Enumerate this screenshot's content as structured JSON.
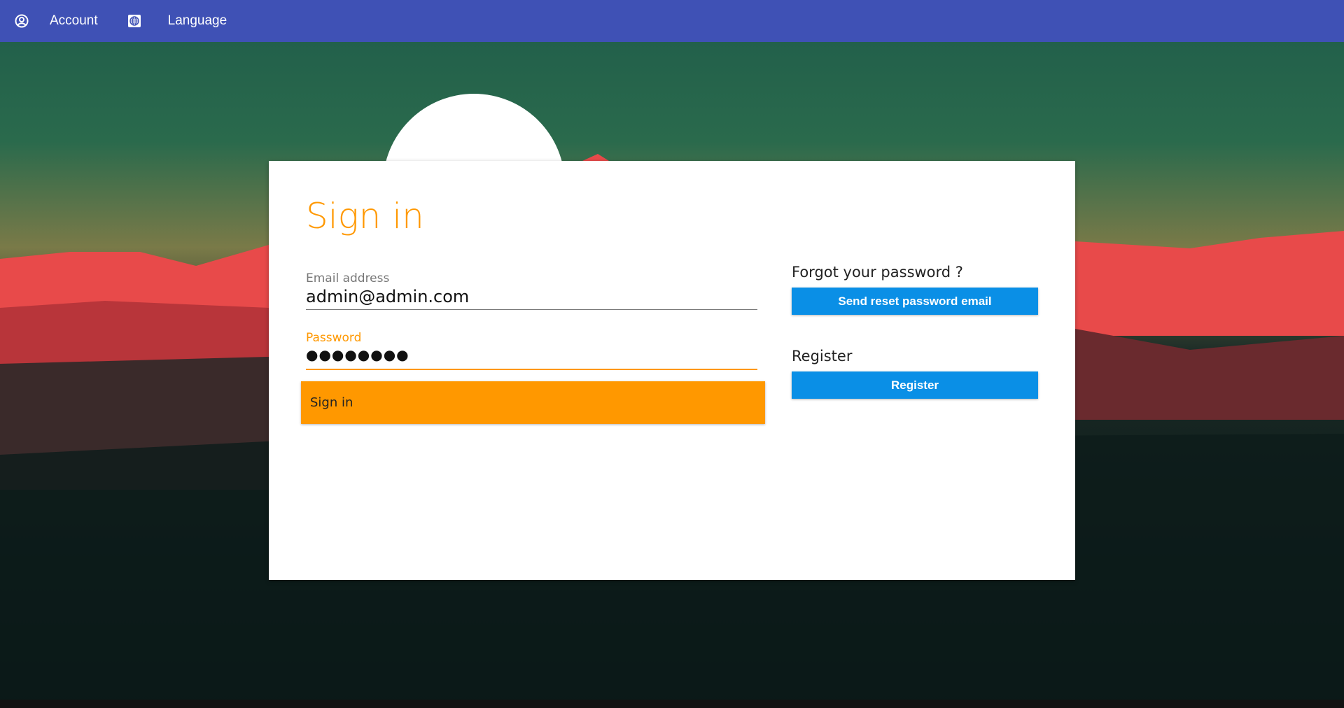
{
  "nav": {
    "account_label": "Account",
    "language_label": "Language",
    "color": "#3f51b5"
  },
  "signin": {
    "title": "Sign in",
    "email_label": "Email address",
    "email_value": "admin@admin.com",
    "password_label": "Password",
    "password_value": "●●●●●●●●",
    "submit_label": "Sign in",
    "accent": "#ff9800"
  },
  "side": {
    "forgot_heading": "Forgot your password ?",
    "reset_button": "Send reset password email",
    "register_heading": "Register",
    "register_button": "Register",
    "button_color": "#0a8fe6"
  }
}
